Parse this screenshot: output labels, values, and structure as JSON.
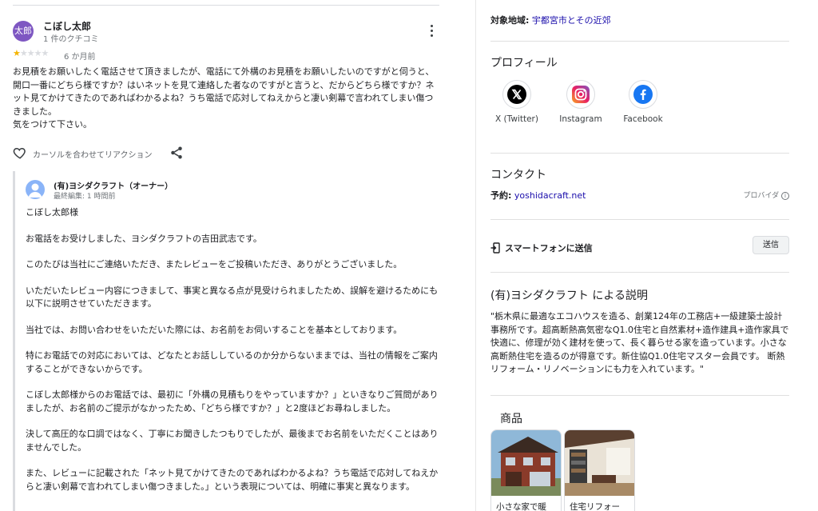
{
  "review": {
    "avatar_text": "太郎",
    "reviewer_name": "こぼし太郎",
    "review_count": "1 件のクチコミ",
    "rating": 1,
    "time": "6 か月前",
    "text": "お見積をお願いしたく電話させて頂きましたが、電話にて外構のお見積をお願いしたいのですがと伺うと、開口一番にどちら様ですか？はいネットを見て連絡した者なのですがと言うと、だからどちら様ですか？ネット見てかけてきたのであればわかるよね？うち電話で応対してねえからと凄い剣幕で言われてしまい傷つきました。\n気をつけて下さい。",
    "reaction_label": "カーソルを合わせてリアクション"
  },
  "owner_reply": {
    "name": "(有)ヨシダクラフト（オーナー）",
    "edited": "最終編集: 1 時間前",
    "paragraphs": [
      "こぼし太郎様",
      "お電話をお受けしました、ヨシダクラフトの吉田武志です。",
      "このたびは当社にご連絡いただき、またレビューをご投稿いただき、ありがとうございました。",
      "いただいたレビュー内容につきまして、事実と異なる点が見受けられましたため、誤解を避けるためにも以下に説明させていただきます。",
      "当社では、お問い合わせをいただいた際には、お名前をお伺いすることを基本としております。",
      "特にお電話での対応においては、どなたとお話ししているのか分からないままでは、当社の情報をご案内することができないからです。",
      "こぼし太郎様からのお電話では、最初に「外構の見積もりをやっていますか？」といきなりご質問がありましたが、お名前のご提示がなかったため、「どちら様ですか？」と2度ほどお尋ねしました。",
      "決して高圧的な口調ではなく、丁寧にお聞きしたつもりでしたが、最後までお名前をいただくことはありませんでした。",
      "また、レビューに記載された「ネット見てかけてきたのであればわかるよね？うち電話で応対してねえからと凄い剣幕で言われてしまい傷つきました。」という表現については、明確に事実と異なります。"
    ]
  },
  "sidebar": {
    "area_label": "対象地域:",
    "area_value": "宇都宮市とその近郊",
    "profile_title": "プロフィール",
    "socials": [
      {
        "label": "X (Twitter)",
        "icon": "x-twitter-icon"
      },
      {
        "label": "Instagram",
        "icon": "instagram-icon"
      },
      {
        "label": "Facebook",
        "icon": "facebook-icon"
      }
    ],
    "contact_title": "コンタクト",
    "reserve_label": "予約:",
    "reserve_link": "yoshidacraft.net",
    "provider_label": "プロバイダ",
    "send_label": "スマートフォンに送信",
    "send_button": "送信",
    "desc_title": "(有)ヨシダクラフト による説明",
    "desc_text": "\"栃木県に最適なエコハウスを造る、創業124年の工務店+一級建築士設計事務所です。超高断熱高気密なQ1.0住宅と自然素材+造作建具+造作家具で快適に、修理が効く建材を使って、長く暮らせる家を造っています。小さな高断熱住宅を造るのが得意です。新住協Q1.0住宅マスター会員です。 断熱リフォーム・リノベーションにも力を入れています。\"",
    "products_title": "商品",
    "products": [
      {
        "caption": "小さな家で暖"
      },
      {
        "caption": "住宅リフォー"
      }
    ]
  },
  "colors": {
    "star": "#f4b400",
    "link": "#1a0dab",
    "avatar": "#7e57c2"
  }
}
